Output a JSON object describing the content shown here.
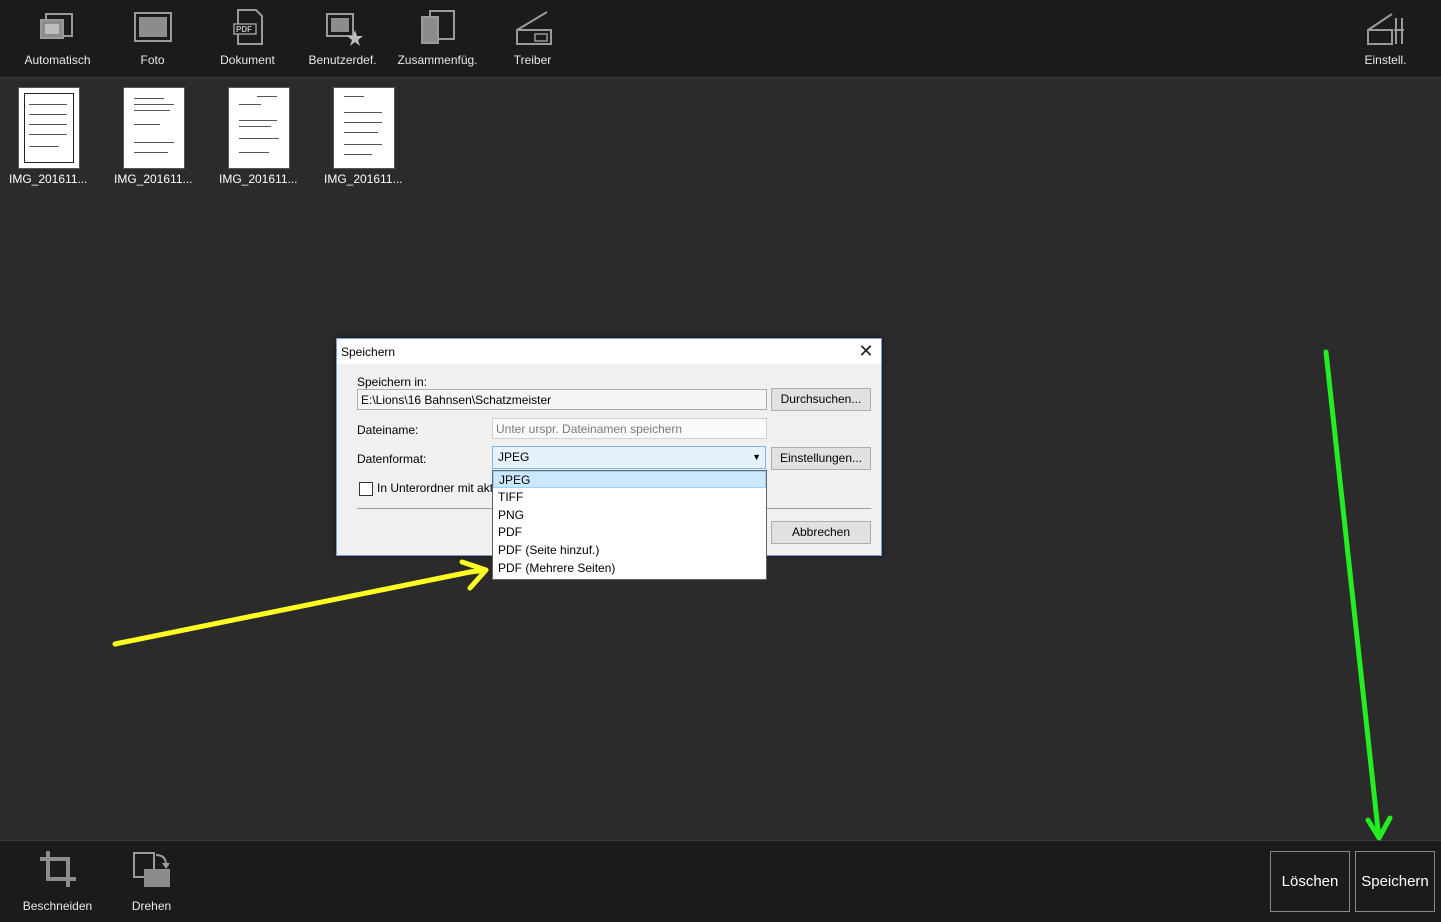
{
  "toolbar": {
    "items": [
      {
        "label": "Automatisch",
        "icon": "auto-scan-icon"
      },
      {
        "label": "Foto",
        "icon": "photo-icon"
      },
      {
        "label": "Dokument",
        "icon": "pdf-document-icon"
      },
      {
        "label": "Benutzerdef.",
        "icon": "custom-star-icon"
      },
      {
        "label": "Zusammenfüg.",
        "icon": "merge-icon"
      },
      {
        "label": "Treiber",
        "icon": "scanner-driver-icon"
      }
    ],
    "settings_label": "Einstell."
  },
  "thumbnails": [
    {
      "caption": "IMG_201611..."
    },
    {
      "caption": "IMG_201611..."
    },
    {
      "caption": "IMG_201611..."
    },
    {
      "caption": "IMG_201611..."
    }
  ],
  "dialog": {
    "title": "Speichern",
    "close_glyph": "✕",
    "save_in_label": "Speichern in:",
    "save_in_value": "E:\\Lions\\16 Bahnsen\\Schatzmeister",
    "browse_label": "Durchsuchen...",
    "filename_label": "Dateiname:",
    "filename_placeholder": "Unter urspr. Dateinamen speichern",
    "format_label": "Datenformat:",
    "format_value": "JPEG",
    "settings_label": "Einstellungen...",
    "subfolder_label": "In Unterordner mit akt",
    "cancel_label": "Abbrechen",
    "format_options": [
      "JPEG",
      "TIFF",
      "PNG",
      "PDF",
      "PDF (Seite hinzuf.)",
      "PDF (Mehrere Seiten)"
    ],
    "selected_option": "JPEG"
  },
  "bottom": {
    "crop_label": "Beschneiden",
    "rotate_label": "Drehen",
    "delete_label": "Löschen",
    "save_label": "Speichern"
  },
  "colors": {
    "toolbar_bg": "#1b1b1b",
    "canvas_bg": "#2b2b2b",
    "arrow_yellow": "#ffff22",
    "arrow_green": "#22ee22"
  }
}
